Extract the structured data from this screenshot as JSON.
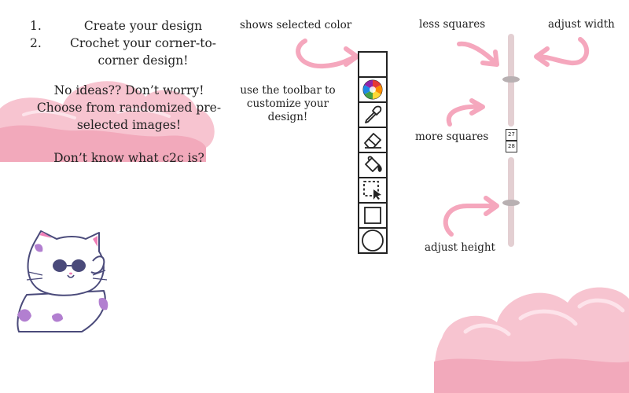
{
  "instructions": {
    "steps": [
      {
        "number": "1.",
        "text": "Create your design"
      },
      {
        "number": "2.",
        "text": "Crochet your corner-to-corner design!"
      }
    ],
    "intro": "No ideas?? Don’t worry! Choose from randomized pre-selected images!",
    "c2c_question": "Don’t know what c2c is?"
  },
  "annotations": {
    "selected_color": "shows selected color",
    "toolbar_hint": "use the toolbar to customize your design!",
    "less_squares": "less squares",
    "more_squares": "more squares",
    "adjust_width": "adjust width",
    "adjust_height": "adjust height"
  },
  "grid": {
    "width_value": "27",
    "height_value": "28"
  },
  "toolbar": {
    "tools": [
      {
        "name": "selected-color-swatch",
        "icon": "empty-swatch"
      },
      {
        "name": "color-wheel",
        "icon": "color-wheel-icon"
      },
      {
        "name": "eyedropper",
        "icon": "eyedropper-icon"
      },
      {
        "name": "eraser",
        "icon": "eraser-icon"
      },
      {
        "name": "paint-bucket",
        "icon": "paint-bucket-icon"
      },
      {
        "name": "select",
        "icon": "selection-cursor-icon"
      },
      {
        "name": "square",
        "icon": "square-icon"
      },
      {
        "name": "circle",
        "icon": "circle-icon"
      }
    ]
  },
  "colors": {
    "cloud": "#f7c4d0",
    "cloud_shadow": "#f2a9bb",
    "arrow": "#f5a7bd",
    "slider_track": "#e3cfd2",
    "slider_thumb": "#b8b0b2",
    "cat_spots": "#b27fd0",
    "cat_outline": "#4a4a7a"
  }
}
